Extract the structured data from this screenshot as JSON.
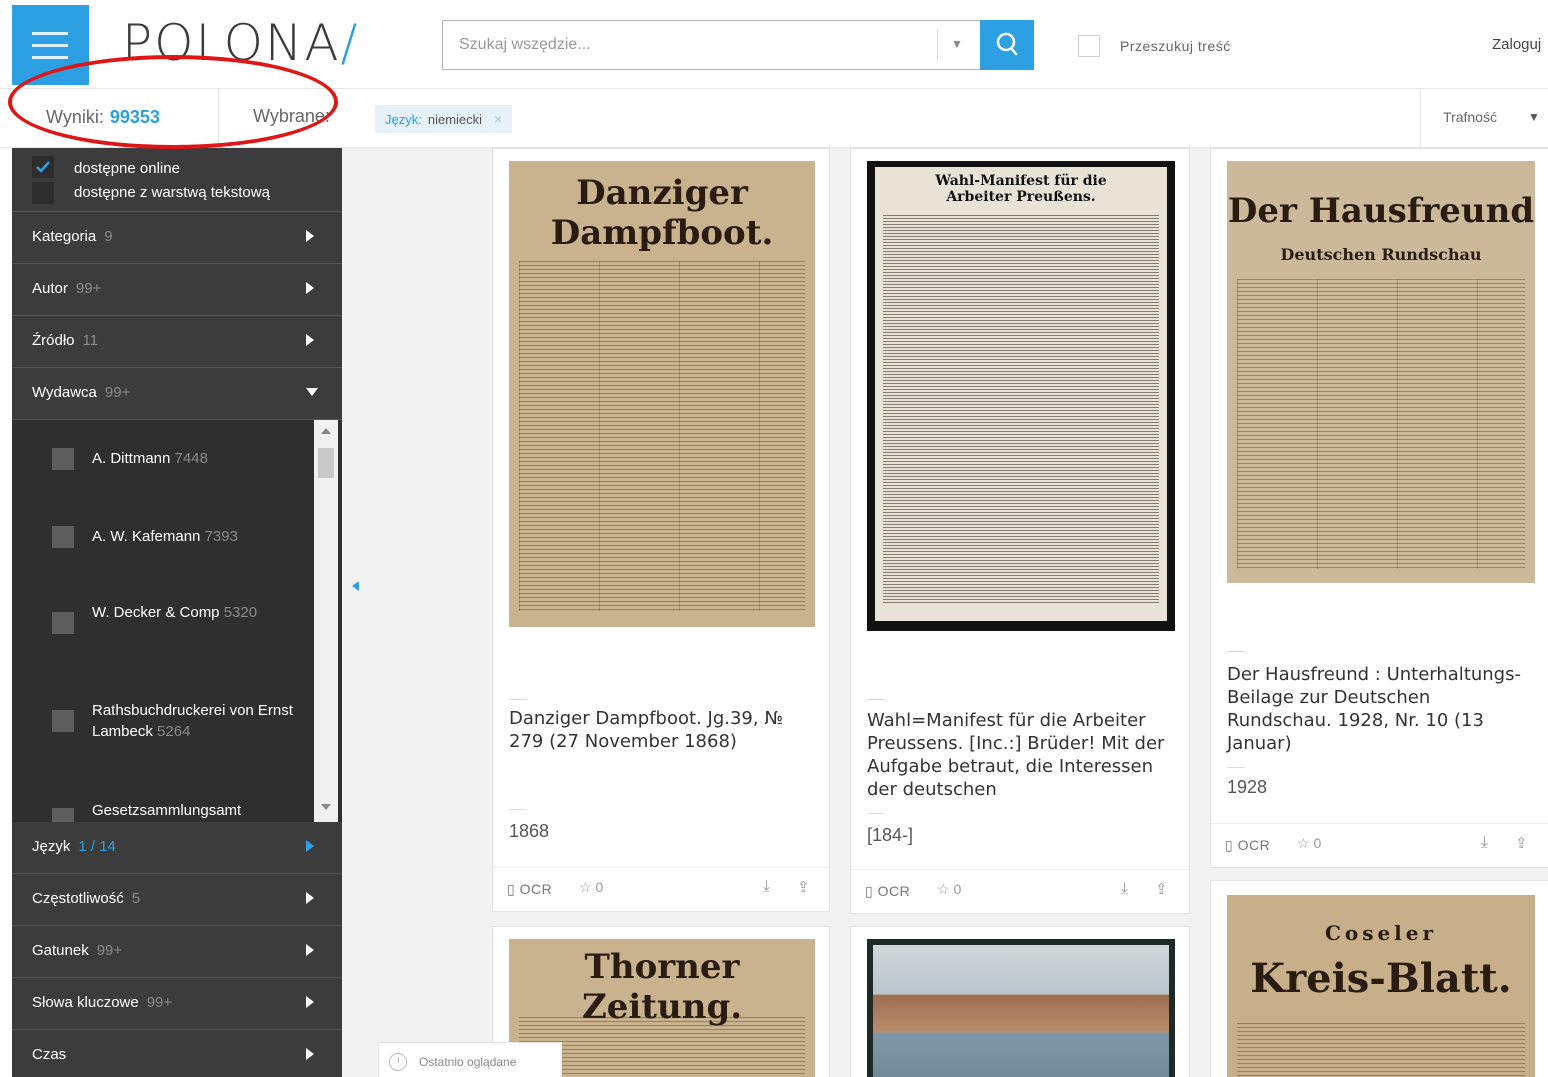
{
  "header": {
    "logo": "POLONA",
    "logo_slash": "/",
    "search_placeholder": "Szukaj wszędzie...",
    "fulltext_label": "Przeszukuj treść",
    "login_label": "Zaloguj"
  },
  "results_bar": {
    "results_label": "Wyniki:",
    "results_count": "99353",
    "selected_label": "Wybrane:",
    "chip_key": "Język:",
    "chip_value": "niemiecki",
    "chip_remove": "×",
    "sort_label": "Trafność"
  },
  "sidebar": {
    "availability": [
      "dostępne online",
      "dostępne z warstwą tekstową"
    ],
    "facets": [
      {
        "name": "Kategoria",
        "count": "9"
      },
      {
        "name": "Autor",
        "count": "99+"
      },
      {
        "name": "Źródło",
        "count": "11"
      },
      {
        "name": "Wydawca",
        "count": "99+"
      },
      {
        "name": "Język",
        "count": "1 / 14"
      },
      {
        "name": "Częstotliwość",
        "count": "5"
      },
      {
        "name": "Gatunek",
        "count": "99+"
      },
      {
        "name": "Słowa kluczowe",
        "count": "99+"
      },
      {
        "name": "Czas",
        "count": ""
      }
    ],
    "publisher_options": [
      {
        "name": "A. Dittmann",
        "count": "7448"
      },
      {
        "name": "A. W. Kafemann",
        "count": "7393"
      },
      {
        "name": "W. Decker & Comp",
        "count": "5320"
      },
      {
        "name": "Rathsbuchdruckerei von Ernst Lambeck",
        "count": "5264"
      },
      {
        "name": "Gesetzsammlungsamt",
        "count": ""
      }
    ],
    "recent_label": "Ostatnio oglądane"
  },
  "cards": [
    {
      "title": "Danziger Dampfboot. Jg.39, № 279 (27 November 1868)",
      "year": "1868",
      "ocr": "OCR",
      "stars": "0",
      "masthead": "Danziger Dampfboot."
    },
    {
      "title": "Wahl=Manifest für die Arbeiter Preussens. [Inc.:] Brüder! Mit der Aufgabe betraut, die Interessen der deutschen",
      "year": "[184-]",
      "ocr": "OCR",
      "stars": "0",
      "masthead": "Wahl-Manifest für die Arbeiter Preußens."
    },
    {
      "title": "Der Hausfreund : Unterhaltungs-Beilage zur Deutschen Rundschau. 1928, Nr. 10 (13 Januar)",
      "year": "1928",
      "ocr": "OCR",
      "stars": "0",
      "masthead": "Der Hausfreund",
      "masthead2": "Deutschen Rundschau"
    },
    {
      "masthead": "Thorner Zeitung."
    },
    {
      "masthead": ""
    },
    {
      "masthead": "Kreis-Blatt.",
      "masthead_top": "Coseler"
    }
  ],
  "colors": {
    "accent": "#2d9fe3",
    "sidebar": "#3c3c3c",
    "annotation": "#e01515"
  }
}
